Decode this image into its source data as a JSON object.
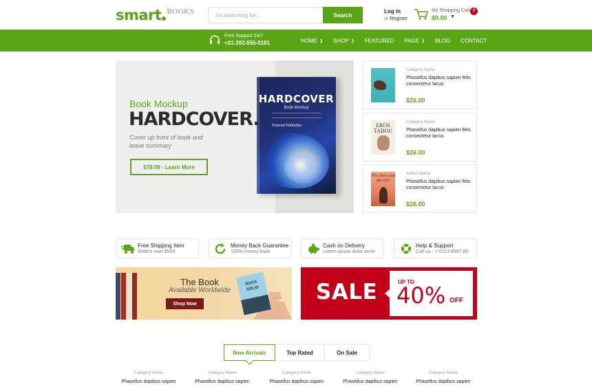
{
  "brand": {
    "logo_main": "smart",
    "logo_sub": "BOOKS",
    "accent": "#5aa516",
    "sale_red": "#c2001a"
  },
  "search": {
    "placeholder": "I'm searching for...",
    "button": "Search"
  },
  "account": {
    "login": "Log in",
    "or": "or",
    "register": "Register"
  },
  "cart": {
    "title": "My Shopping Cart",
    "total": "$0.00",
    "count": "0",
    "icon": "cart-icon"
  },
  "support": {
    "line1": "Free Support 24/7",
    "phone": "+01-202-555-0181",
    "icon": "headset-icon"
  },
  "menu": [
    {
      "label": "HOME",
      "dropdown": true
    },
    {
      "label": "SHOP",
      "dropdown": true
    },
    {
      "label": "FEATURED",
      "dropdown": false
    },
    {
      "label": "PAGE",
      "dropdown": true
    },
    {
      "label": "BLOG",
      "dropdown": false
    },
    {
      "label": "CONTACT",
      "dropdown": false
    }
  ],
  "hero": {
    "kicker": "Book Mockup",
    "title": "HARDCOVER.",
    "description": "Cover up front of book and leave summary",
    "button": "$78.09 - Learn More",
    "book_title": "HARDCOVER",
    "book_subtitle": "Book Mockup",
    "book_signature": "Pretend Publisher"
  },
  "side_products": [
    {
      "category": "Category Name",
      "name": "Phasellus dapibus sapien felis consectetur lacus",
      "price": "$26.00"
    },
    {
      "category": "Category Name",
      "name": "Phasellus dapibus sapien felis consectetur lacus",
      "price": "$26.00",
      "cover_text": "EROS TABOU"
    },
    {
      "category": "Author Name",
      "name": "Phasellus dapibus sapien felis consectetur lacus",
      "price": "$26.00",
      "cover_text": "The Dress and the Girl"
    }
  ],
  "features": [
    {
      "title": "Free Shipping Item",
      "subtitle": "Orders over $500",
      "icon": "truck-icon"
    },
    {
      "title": "Money Back Guarantee",
      "subtitle": "100% money back",
      "icon": "refresh-icon"
    },
    {
      "title": "Cash on Delivery",
      "subtitle": "Lorem ipsum dolor amet",
      "icon": "piggy-bank-icon"
    },
    {
      "title": "Help & Support",
      "subtitle": "Call us : + 0123.4567.89",
      "icon": "lifebuoy-icon"
    }
  ],
  "banner_book": {
    "title": "The Book",
    "subtitle": "Available Worldwide",
    "button": "Shop Now",
    "book_text": "ROCK SOLID"
  },
  "banner_sale": {
    "sale": "SALE",
    "up_to": "UP TO",
    "percent": "40%",
    "off": "OFF"
  },
  "tabs": [
    {
      "label": "New Arrivals",
      "active": true
    },
    {
      "label": "Top Rated",
      "active": false
    },
    {
      "label": "On Sale",
      "active": false
    }
  ],
  "bottom_products": [
    {
      "category": "Category Name",
      "name": "Phasellus dapibus sapien"
    },
    {
      "category": "Category Name",
      "name": "Phasellus dapibus sapien"
    },
    {
      "category": "Category Name",
      "name": "Phasellus dapibus sapien"
    },
    {
      "category": "Category Name",
      "name": "Phasellus dapibus sapien"
    },
    {
      "category": "Category Name",
      "name": "Phasellus dapibus sapien"
    }
  ]
}
